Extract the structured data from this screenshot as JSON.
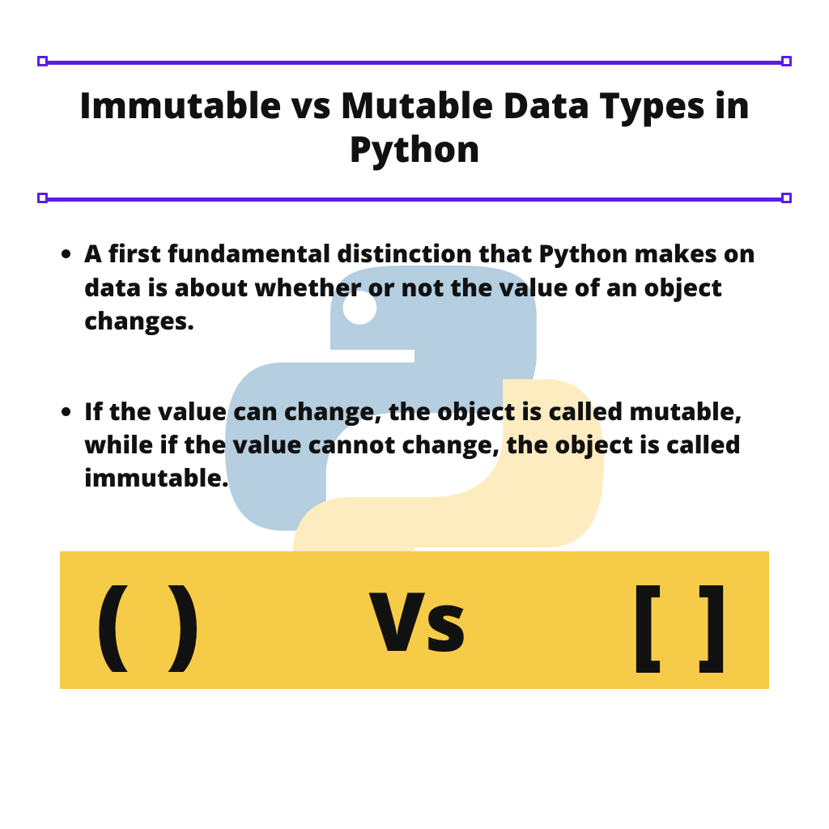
{
  "title": "Immutable vs Mutable Data Types in Python",
  "bullets": {
    "item1": "A first fundamental distinction that Python makes on data is about whether or not the value of an object changes.",
    "item2": "If the value can change, the object is called mutable, while if the value cannot change, the object is called immutable."
  },
  "comparison": {
    "left": "( )",
    "center": "Vs",
    "right": "[ ]"
  },
  "colors": {
    "accent": "#5a1ee6",
    "card_bg": "#f6cb47",
    "logo_blue": "#b5cee0",
    "logo_yellow": "#fdecc0"
  }
}
